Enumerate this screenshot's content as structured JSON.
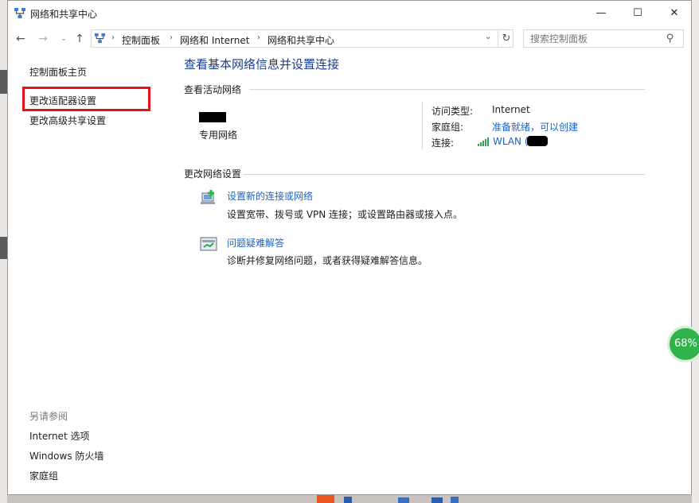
{
  "window": {
    "title": "网络和共享中心",
    "controls": {
      "minimize": "—",
      "maximize": "☐",
      "close": "✕"
    }
  },
  "nav": {
    "back": "←",
    "forward": "→",
    "recent": "⌄",
    "up": "↑",
    "breadcrumb": [
      "控制面板",
      "网络和 Internet",
      "网络和共享中心"
    ],
    "separator": "›",
    "dropdown": "⌄",
    "refresh": "↻",
    "search_placeholder": "搜索控制面板"
  },
  "left_pane": {
    "home": "控制面板主页",
    "change_adapter": "更改适配器设置",
    "change_sharing": "更改高级共享设置",
    "see_also": "另请参阅",
    "see_also_links": [
      "Internet 选项",
      "Windows 防火墙",
      "家庭组"
    ],
    "highlight_color": "#e2141d"
  },
  "main": {
    "title": "查看基本网络信息并设置连接",
    "active_networks_heading": "查看活动网络",
    "network": {
      "type": "专用网络",
      "access_type_label": "访问类型:",
      "access_type_value": "Internet",
      "homegroup_label": "家庭组:",
      "homegroup_value": "准备就绪，可以创建",
      "connection_label": "连接:",
      "connection_value": "WLAN ("
    },
    "change_settings_heading": "更改网络设置",
    "tasks": [
      {
        "link": "设置新的连接或网络",
        "desc": "设置宽带、拨号或 VPN 连接；或设置路由器或接入点。"
      },
      {
        "link": "问题疑难解答",
        "desc": "诊断并修复网络问题，或者获得疑难解答信息。"
      }
    ]
  },
  "overlay": {
    "battery_badge": "68%"
  },
  "colors": {
    "link": "#1a63c6",
    "title": "#1a3d8f",
    "accent_green": "#2fb34a"
  }
}
